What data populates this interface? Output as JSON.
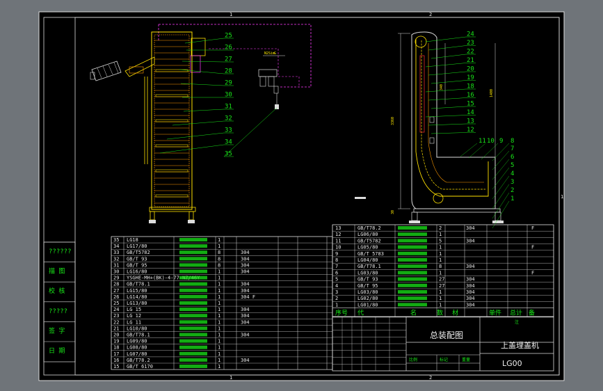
{
  "frame": {
    "zone_top_left": "1",
    "zone_top_right": "2",
    "zone_bottom_left": "1",
    "zone_bottom_right": "2",
    "zone_right_mark": "1"
  },
  "left_view": {
    "balloons": [
      "25",
      "26",
      "27",
      "28",
      "29",
      "30",
      "31",
      "32",
      "33",
      "34",
      "35"
    ],
    "motor_labels": [
      "G",
      "N2Sim"
    ]
  },
  "right_view": {
    "balloons_column": [
      "24",
      "23",
      "22",
      "21",
      "20",
      "19",
      "18",
      "16",
      "15",
      "14",
      "13",
      "12"
    ],
    "balloons_bottom": [
      "11",
      "10",
      "9",
      "8",
      "7",
      "6",
      "5",
      "4",
      "3",
      "2",
      "1"
    ],
    "dim_vertical": "3360",
    "dim_top": "340",
    "dim_right": "1400",
    "dim_base": "500",
    "dim_left_base": "30"
  },
  "left_panel": {
    "rows": [
      "??????",
      "描  图",
      "校  核",
      "?????",
      "签  字",
      "日  期"
    ]
  },
  "bom_left": {
    "rows": [
      {
        "no": "35",
        "code": "LG18",
        "qty": "1",
        "mat": ""
      },
      {
        "no": "34",
        "code": "LG17/80",
        "qty": "1",
        "mat": ""
      },
      {
        "no": "33",
        "code": "GB/T5782",
        "qty": "8",
        "mat": "304"
      },
      {
        "no": "32",
        "code": "GB/T 93",
        "qty": "8",
        "mat": "304"
      },
      {
        "no": "31",
        "code": "GB/T 95",
        "qty": "8",
        "mat": "304"
      },
      {
        "no": "30",
        "code": "LG16/80",
        "qty": "1",
        "mat": "304"
      },
      {
        "no": "29",
        "code": "YSGHE-MH+(BK)-4-77-NZ/46Y",
        "qty": "1",
        "mat": ""
      },
      {
        "no": "28",
        "code": "GB/T78.1",
        "qty": "1",
        "mat": "304"
      },
      {
        "no": "27",
        "code": "LG15/80",
        "qty": "1",
        "mat": "304"
      },
      {
        "no": "26",
        "code": "LG14/80",
        "qty": "1",
        "mat": "304 F"
      },
      {
        "no": "25",
        "code": "LG13/80",
        "qty": "1",
        "mat": ""
      },
      {
        "no": "24",
        "code": "LG 15",
        "qty": "1",
        "mat": "304"
      },
      {
        "no": "23",
        "code": "LG 12",
        "qty": "1",
        "mat": "304"
      },
      {
        "no": "22",
        "code": "LG 11",
        "qty": "1",
        "mat": "304"
      },
      {
        "no": "21",
        "code": "LG10/80",
        "qty": "1",
        "mat": ""
      },
      {
        "no": "20",
        "code": "GB/T78.1",
        "qty": "1",
        "mat": "304"
      },
      {
        "no": "19",
        "code": "LG09/80",
        "qty": "1",
        "mat": ""
      },
      {
        "no": "18",
        "code": "LG08/80",
        "qty": "1",
        "mat": ""
      },
      {
        "no": "17",
        "code": "LG07/80",
        "qty": "1",
        "mat": ""
      },
      {
        "no": "16",
        "code": "GB/T78.2",
        "qty": "1",
        "mat": "304"
      },
      {
        "no": "15",
        "code": "GB/T 6170",
        "qty": "1",
        "mat": ""
      }
    ]
  },
  "bom_right": {
    "rows": [
      {
        "no": "13",
        "code": "GB/T78.2",
        "qty": "2",
        "mat": "304",
        "note": "F"
      },
      {
        "no": "12",
        "code": "LG06/80",
        "qty": "1",
        "mat": ""
      },
      {
        "no": "11",
        "code": "GB/T5782",
        "qty": "5",
        "mat": "304"
      },
      {
        "no": "10",
        "code": "LG05/80",
        "qty": "1",
        "mat": "",
        "note": "F"
      },
      {
        "no": "9",
        "code": "GB/T 5783",
        "qty": "1",
        "mat": ""
      },
      {
        "no": "8",
        "code": "LG04/80",
        "qty": "1",
        "mat": ""
      },
      {
        "no": "7",
        "code": "GB/T78.1",
        "qty": "8",
        "mat": "304"
      },
      {
        "no": "6",
        "code": "LG03/80",
        "qty": "1",
        "mat": "",
        "note": "F"
      },
      {
        "no": "5",
        "code": "GB/T 93",
        "qty": "27",
        "mat": "304"
      },
      {
        "no": "4",
        "code": "GB/T 95",
        "qty": "27",
        "mat": "304"
      },
      {
        "no": "3",
        "code": "LG03/80",
        "qty": "1",
        "mat": "304"
      },
      {
        "no": "2",
        "code": "LG02/80",
        "qty": "1",
        "mat": "304"
      },
      {
        "no": "1",
        "code": "LG01/80",
        "qty": "1",
        "mat": "304"
      }
    ],
    "header": [
      "序号",
      "代",
      "名",
      "数",
      "材",
      "单件",
      "总计",
      "备"
    ]
  },
  "title_block": {
    "drawing_name": "总装配图",
    "product_name": "上盖理盖机",
    "drawing_number": "LG00",
    "label_company": "注",
    "label_scale": "比例",
    "label_mark": "标记",
    "label_weight": "重量"
  }
}
